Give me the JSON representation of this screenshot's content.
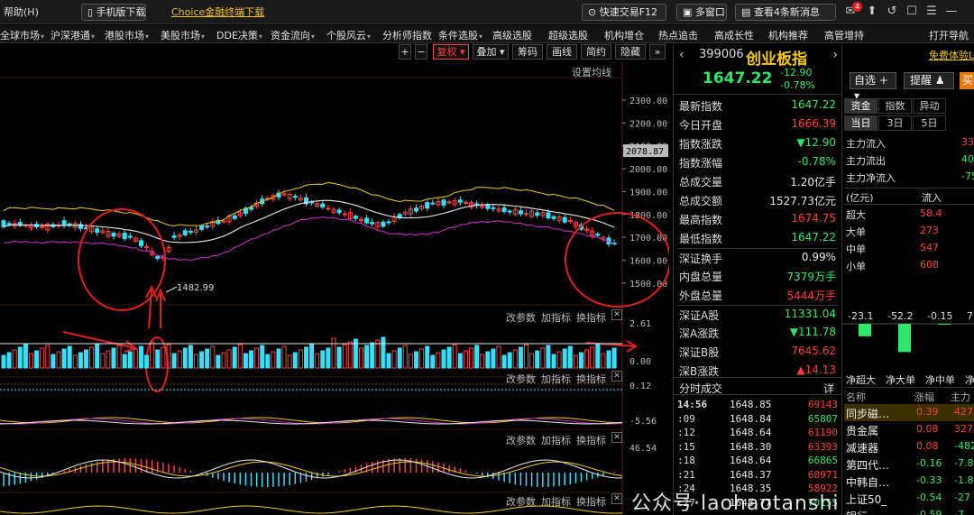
{
  "topbar": {
    "help": "帮助(H)",
    "mobile_download": "手机版下载",
    "terminal_download": "Choice金融终端下载",
    "quick_trade": "快速交易F12",
    "multi_window": "多窗口",
    "news": "查看4条新消息",
    "mail_count": "4"
  },
  "menu": [
    "全球市场",
    "沪深港通",
    "港股市场",
    "美股市场",
    "DDE决策",
    "资金流向",
    "个股风云",
    "分析师指数",
    "条件选股",
    "高级选股",
    "超级选股",
    "机构增仓",
    "热点追击",
    "高成长性",
    "机构推荐",
    "高管增持",
    "打开导航"
  ],
  "chart_toolbar": {
    "plus": "+",
    "minus": "−",
    "fq": "复权",
    "overlay": "叠加",
    "chips": "筹码",
    "draw": "画线",
    "simple": "简约",
    "hide": "隐藏",
    "more": "»"
  },
  "main_pane": {
    "settings": "设置均线",
    "price_axis": [
      "2300.00",
      "2200.00",
      "2100.00",
      "2000.00",
      "1900.00",
      "1800.00",
      "1700.00",
      "1600.00",
      "1500.00"
    ],
    "last_price_tag": "2078.87",
    "low_annotation": "1482.99"
  },
  "sub_panes": {
    "change_params": "改参数",
    "add_indicator": "加指标",
    "switch_indicator": "换指标",
    "close": "✕",
    "vol_axis": [
      "2.61",
      "0.00"
    ],
    "p2_axis": [
      "0.12"
    ],
    "p3_axis": [
      "-5.56"
    ],
    "p4_axis": [
      "46.54"
    ]
  },
  "quote": {
    "code": "399006",
    "name": "创业板指",
    "price": "1647.22",
    "change": "-12.90",
    "change_pct": "-0.78%",
    "rows": [
      {
        "k": "最新指数",
        "v": "1647.22",
        "c": "green"
      },
      {
        "k": "今日开盘",
        "v": "1666.39",
        "c": "red"
      },
      {
        "k": "指数涨跌",
        "v": "▼12.90",
        "c": "green"
      },
      {
        "k": "指数涨幅",
        "v": "-0.78%",
        "c": "green"
      },
      {
        "k": "总成交量",
        "v": "1.20亿手",
        "c": "white"
      },
      {
        "k": "总成交额",
        "v": "1527.73亿元",
        "c": "white"
      },
      {
        "k": "最高指数",
        "v": "1674.75",
        "c": "red"
      },
      {
        "k": "最低指数",
        "v": "1647.22",
        "c": "green"
      },
      {
        "k": "深证换手",
        "v": "0.99%",
        "c": "white"
      },
      {
        "k": "内盘总量",
        "v": "7379万手",
        "c": "green"
      },
      {
        "k": "外盘总量",
        "v": "5444万手",
        "c": "red"
      },
      {
        "k": "深证A股",
        "v": "11331.04",
        "c": "green"
      },
      {
        "k": "深A涨跌",
        "v": "▼111.78",
        "c": "green"
      },
      {
        "k": "深证B股",
        "v": "7645.62",
        "c": "red"
      },
      {
        "k": "深B涨跌",
        "v": "▲14.13",
        "c": "red"
      }
    ],
    "ticks_title": "分时成交",
    "ticks_detail": "详",
    "ticks": [
      {
        "t": "14:56",
        "p": "1648.85",
        "v": "69143"
      },
      {
        "t": ":09",
        "p": "1648.84",
        "v": "65807"
      },
      {
        "t": ":12",
        "p": "1648.64",
        "v": "61190"
      },
      {
        "t": ":15",
        "p": "1648.30",
        "v": "63393"
      },
      {
        "t": ":18",
        "p": "1648.64",
        "v": "66865"
      },
      {
        "t": ":21",
        "p": "1648.37",
        "v": "60971"
      },
      {
        "t": ":24",
        "p": "1648.35",
        "v": "58922"
      },
      {
        "t": ":27",
        "p": "1648.77",
        "v": "70155"
      }
    ]
  },
  "flow": {
    "free_trial": "免费体验L",
    "auto_select": "自选",
    "remind": "提醒",
    "buy": "买",
    "tabs1": [
      "资金",
      "指数",
      "异动"
    ],
    "tabs2": [
      "当日",
      "3日",
      "5日"
    ],
    "main_rows": [
      {
        "k": "主力流入",
        "v": "33",
        "c": "red"
      },
      {
        "k": "主力流出",
        "v": "40",
        "c": "green"
      },
      {
        "k": "主力净流入",
        "v": "-75.",
        "c": "green"
      }
    ],
    "unit": "(亿元)",
    "in_label": "流入",
    "size_rows": [
      {
        "k": "超大",
        "v": "58.4",
        "c": "red"
      },
      {
        "k": "大单",
        "v": "273",
        "c": "red"
      },
      {
        "k": "中单",
        "v": "547",
        "c": "red"
      },
      {
        "k": "小单",
        "v": "608",
        "c": "red"
      }
    ],
    "bar_values": [
      "-23.1",
      "-52.2",
      "-0.15",
      "7"
    ],
    "bar_labels": [
      "净超大",
      "净大单",
      "净中单",
      "净"
    ],
    "sector_header": [
      "名称",
      "涨幅",
      "主力"
    ],
    "sectors": [
      {
        "n": "同步磁…",
        "p": "0.39",
        "m": "427",
        "pc": "red",
        "mc": "red"
      },
      {
        "n": "贵金属",
        "p": "0.08",
        "m": "327",
        "pc": "red",
        "mc": "red"
      },
      {
        "n": "减速器",
        "p": "0.08",
        "m": "-482",
        "pc": "red",
        "mc": "green"
      },
      {
        "n": "第四代…",
        "p": "-0.16",
        "m": "-7.8",
        "pc": "green",
        "mc": "green"
      },
      {
        "n": "中韩自…",
        "p": "-0.33",
        "m": "-1.8",
        "pc": "green",
        "mc": "green"
      },
      {
        "n": "上证50_",
        "p": "-0.54",
        "m": "-27",
        "pc": "green",
        "mc": "green"
      },
      {
        "n": "银行",
        "p": "-0.59",
        "m": "-7",
        "pc": "green",
        "mc": "green"
      }
    ]
  },
  "watermark": "公众号·laohaotanshi",
  "colors": {
    "up": "#ff3b3b",
    "down": "#2ee66a",
    "cyan": "#00e5ff",
    "yellow": "#f2c811",
    "magenta": "#e040fb"
  }
}
